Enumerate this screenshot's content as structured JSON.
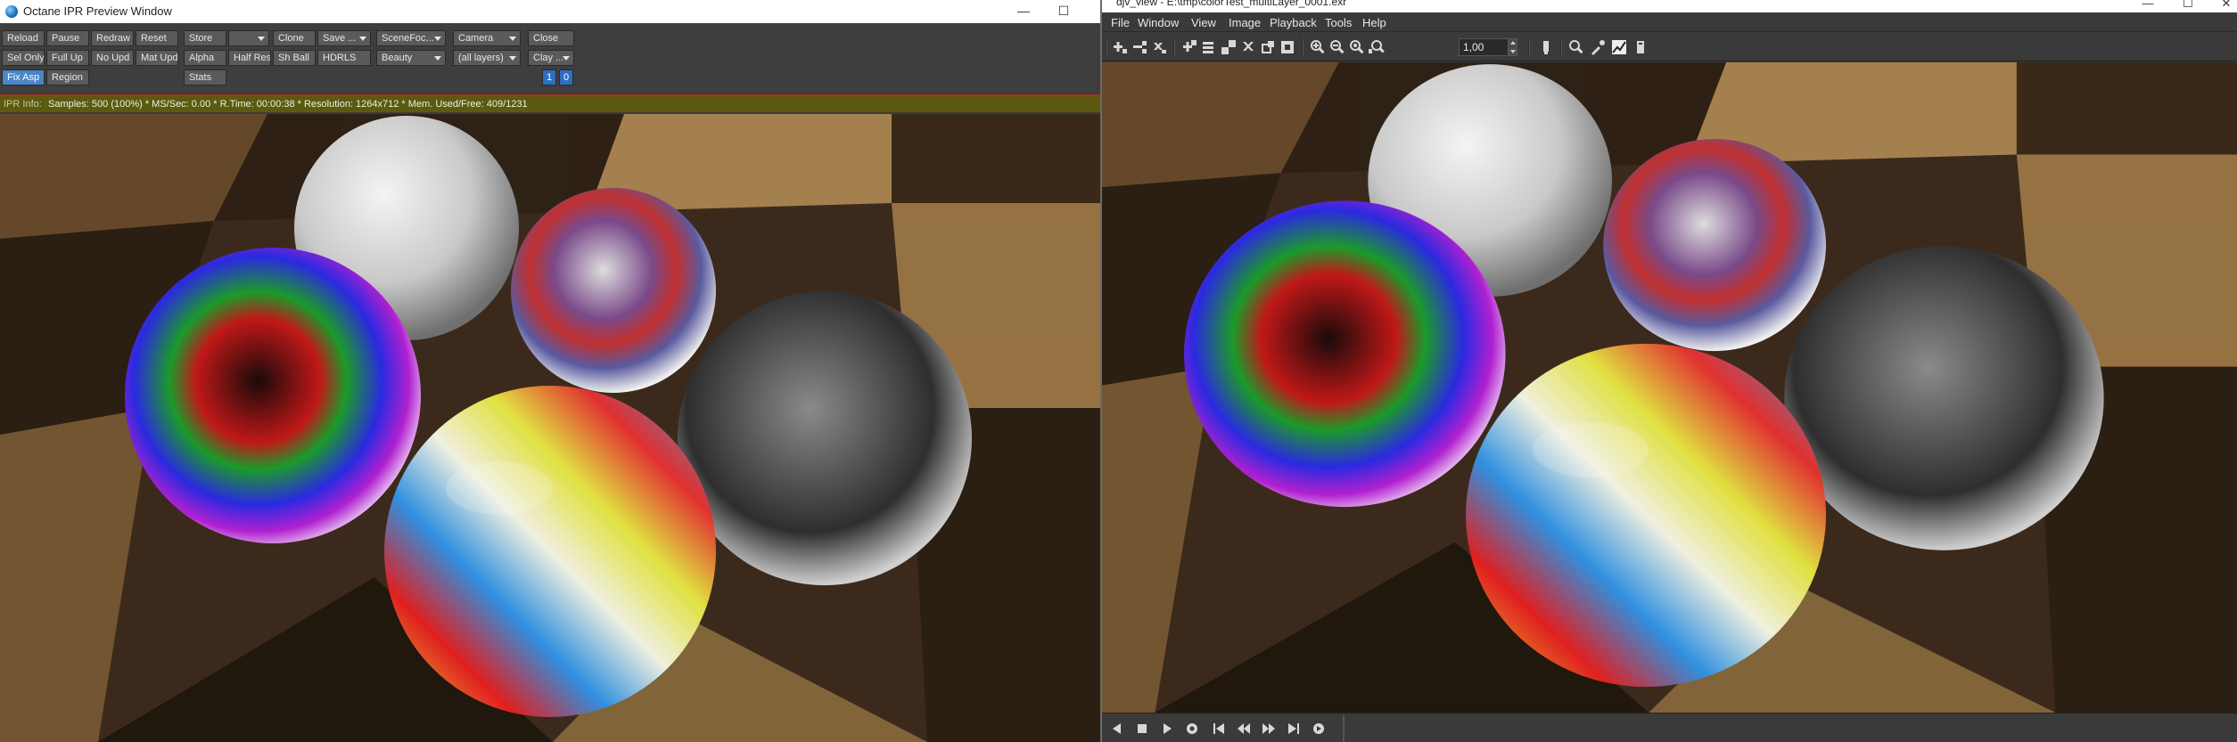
{
  "left_window": {
    "title": "Octane IPR Preview Window",
    "minimize": "—",
    "maximize": "☐",
    "toolbar": {
      "row1": [
        "Reload",
        "Pause",
        "Redraw",
        "Reset",
        "Store",
        "",
        "Clone",
        "Save ...",
        "SceneFoc...",
        "Camera",
        "Close"
      ],
      "row2": [
        "Sel Only",
        "Full Up",
        "No Upd",
        "Mat Upd",
        "Alpha",
        "Half Res",
        "Sh Ball",
        "HDRLS",
        "Beauty",
        "(all layers)",
        "Clay ..."
      ],
      "row3": [
        "Fix Asp",
        "Region",
        "Stats",
        "1",
        "0"
      ]
    },
    "ipr_info": {
      "label": "IPR Info:",
      "text": "Samples: 500 (100%)  *  MS/Sec: 0.00  *  R.Time: 00:00:38  *  Resolution: 1264x712  *  Mem. Used/Free: 409/1231"
    }
  },
  "right_window": {
    "title": "djv_view - E:\\tmp\\colorTest_multiLayer_0001.exr",
    "window_buttons": [
      "—",
      "☐",
      "✕"
    ],
    "menu": [
      "File",
      "Window",
      "View",
      "Image",
      "Playback",
      "Tools",
      "Help"
    ],
    "zoom_value": "1,00",
    "toolbar_icons": [
      "new-window-icon",
      "copy-icon",
      "close-icon",
      "fit-icon",
      "view-icon",
      "layer-icon",
      "cross-icon",
      "square-icon",
      "mask-icon",
      "zoom-in-icon",
      "zoom-out-icon",
      "zoom-reset-icon",
      "zoom-fit-icon",
      "zoom-spinbox",
      "channel-icon",
      "magnify-icon",
      "color-picker-icon",
      "histogram-icon",
      "info-icon"
    ],
    "playback_icons": [
      "prev-frame-icon",
      "stop-icon",
      "play-icon",
      "record-icon",
      "first-frame-icon",
      "step-back-icon",
      "step-forward-icon",
      "last-frame-icon",
      "loop-icon"
    ]
  },
  "colors": {
    "ui_bg": "#3b3b3b",
    "button_bg": "#5a5a5a",
    "active_button": "#4a86c8",
    "ipr_bar": "#5c5a10",
    "ipr_border": "#b03010"
  }
}
